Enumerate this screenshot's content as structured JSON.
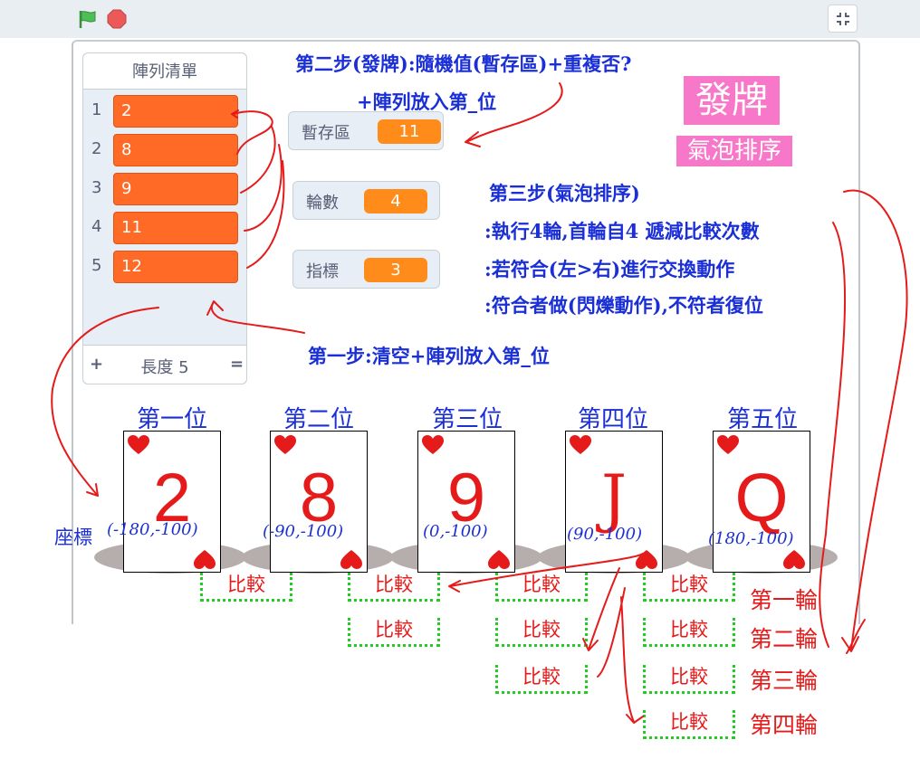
{
  "toolbar": {
    "green_flag_icon": "green-flag-icon",
    "stop_icon": "stop-icon",
    "fullscreen_icon": "exit-fullscreen-icon"
  },
  "list_monitor": {
    "title": "陣列清單",
    "items": [
      {
        "index": "1",
        "value": "2"
      },
      {
        "index": "2",
        "value": "8"
      },
      {
        "index": "3",
        "value": "9"
      },
      {
        "index": "4",
        "value": "11"
      },
      {
        "index": "5",
        "value": "12"
      }
    ],
    "add_symbol": "+",
    "length_text": "長度 5",
    "resize_symbol": "="
  },
  "variables": {
    "temp": {
      "label": "暫存區",
      "value": "11"
    },
    "rounds": {
      "label": "輪數",
      "value": "4"
    },
    "pointer": {
      "label": "指標",
      "value": "3"
    }
  },
  "buttons": {
    "deal": "發牌",
    "bubble_sort": "氣泡排序"
  },
  "notes": {
    "step2_line1": "第二步(發牌):隨機值(暫存區)+重複否?",
    "step2_line2": "+陣列放入第_位",
    "step3_line1": "第三步(氣泡排序)",
    "step3_line2": ":執行4輪,首輪自4 遞減比較次數",
    "step3_line3": ":若符合(左>右)進行交換動作",
    "step3_line4": ":符合者做(閃爍動作),不符者復位",
    "step1": "第一步:清空+陣列放入第_位"
  },
  "positions": [
    "第一位",
    "第二位",
    "第三位",
    "第四位",
    "第五位"
  ],
  "cards": [
    {
      "rank": "2",
      "coord": "(-180,-100)"
    },
    {
      "rank": "8",
      "coord": "(-90,-100)"
    },
    {
      "rank": "9",
      "coord": "(0,-100)"
    },
    {
      "rank": "J",
      "coord": "(90,-100)"
    },
    {
      "rank": "Q",
      "coord": "(180,-100)"
    }
  ],
  "coord_label": "座標",
  "compare_label": "比較",
  "rounds_labels": [
    "第一輪",
    "第二輪",
    "第三輪",
    "第四輪"
  ],
  "colors": {
    "list_item": "#ff6b26",
    "variable_value": "#ff8c1a",
    "button_pink": "#f778c8",
    "annotation_blue": "#1a2fd6",
    "annotation_red": "#e51b1b",
    "compare_box_green": "#22cc22"
  }
}
